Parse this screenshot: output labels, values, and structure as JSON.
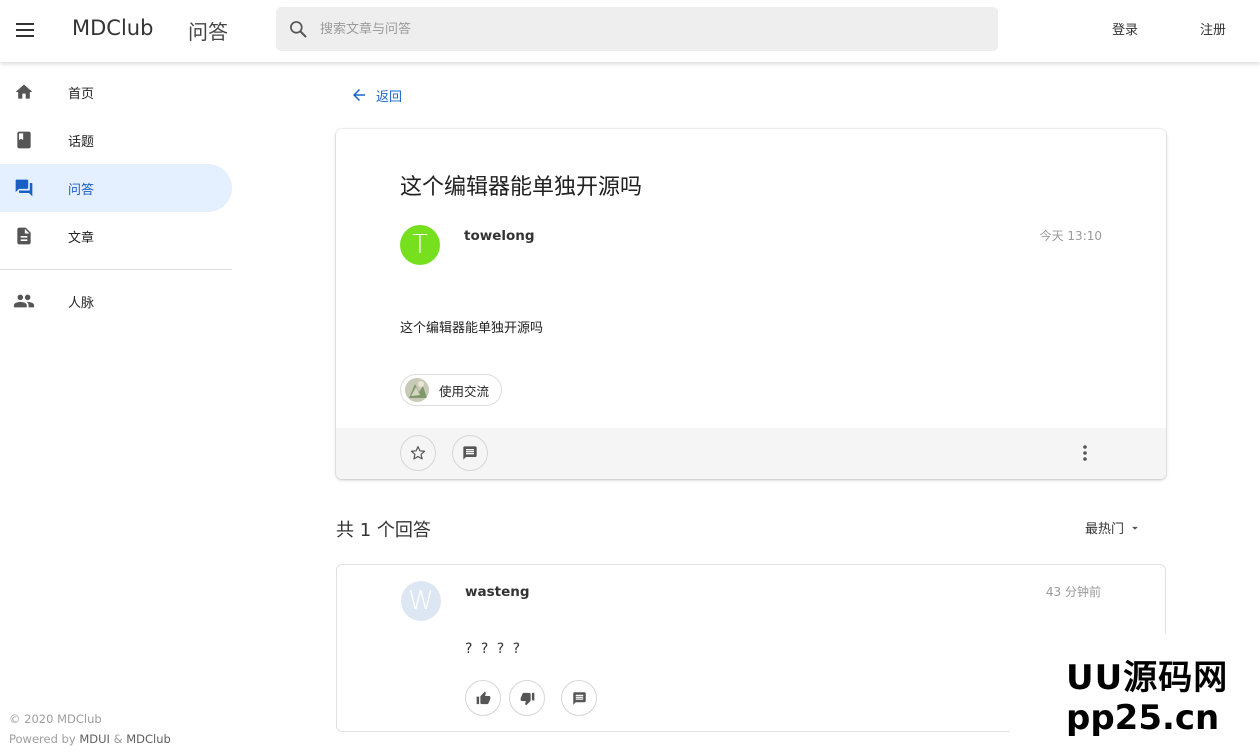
{
  "header": {
    "brand": "MDClub",
    "section": "问答",
    "search_placeholder": "搜索文章与问答",
    "login": "登录",
    "register": "注册"
  },
  "sidebar": {
    "items": [
      {
        "label": "首页",
        "icon": "home-icon"
      },
      {
        "label": "话题",
        "icon": "book-icon"
      },
      {
        "label": "问答",
        "icon": "forum-icon",
        "active": true
      },
      {
        "label": "文章",
        "icon": "description-icon"
      },
      {
        "label": "人脉",
        "icon": "people-icon"
      }
    ],
    "footer": {
      "copyright": "© 2020 MDClub",
      "powered_prefix": "Powered by",
      "powered_mdui": "MDUI",
      "powered_amp": "&",
      "powered_mdclub": "MDClub"
    }
  },
  "back": {
    "label": "返回"
  },
  "question": {
    "title": "这个编辑器能单独开源吗",
    "author": "towelong",
    "avatar_letter": "T",
    "time": "今天 13:10",
    "body": "这个编辑器能单独开源吗",
    "topic": "使用交流"
  },
  "answers": {
    "count_label": "共 1 个回答",
    "sort_label": "最热门",
    "items": [
      {
        "author": "wasteng",
        "avatar_letter": "W",
        "time": "43 分钟前",
        "body": "? ? ? ?"
      }
    ]
  },
  "watermark": {
    "line1": "UU源码网",
    "line2": "pp25.cn"
  },
  "colors": {
    "accent": "#1a67c9",
    "active_nav_bg": "#e4efff",
    "avatar_t": "#76e01f",
    "avatar_w": "#dde7f3"
  }
}
